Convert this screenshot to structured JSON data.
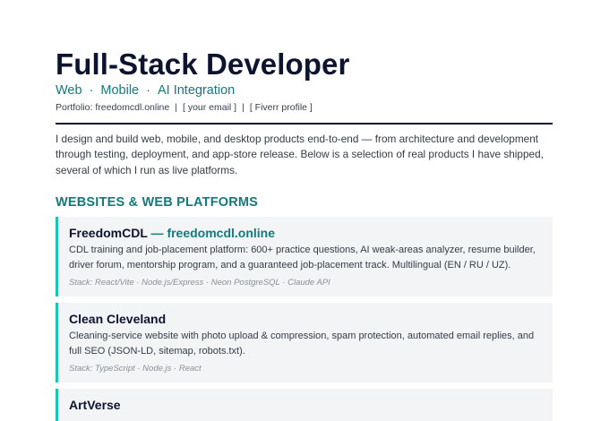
{
  "header": {
    "name": "Full-Stack Developer",
    "roles": [
      "Web",
      "Mobile",
      "AI Integration"
    ],
    "role_separator": "·",
    "links": {
      "portfolio": "Portfolio: freedomcdl.online",
      "email": "[ your email ]",
      "fiverr": "[ Fiverr profile ]",
      "separator": "|"
    }
  },
  "intro": "I design and build web, mobile, and desktop products end-to-end — from architecture and development through testing, deployment, and app-store release. Below is a selection of real products I have shipped, several of which I run as live platforms.",
  "section": {
    "title": "WEBSITES & WEB PLATFORMS"
  },
  "projects": [
    {
      "name": "FreedomCDL",
      "dash": " — ",
      "domain": "freedomcdl.online",
      "description": "CDL training and job-placement platform: 600+ practice questions, AI weak-areas analyzer, resume builder, driver forum, mentorship program, and a guaranteed job-placement track. Multilingual (EN / RU / UZ).",
      "stack": "Stack: React/Vite · Node.js/Express · Neon PostgreSQL · Claude API"
    },
    {
      "name": "Clean Cleveland",
      "description": "Cleaning-service website with photo upload & compression, spam protection, automated email replies, and full SEO (JSON-LD, sitemap, robots.txt).",
      "stack": "Stack: TypeScript · Node.js · React"
    },
    {
      "name": "ArtVerse"
    }
  ],
  "colors": {
    "heading": "#0d1430",
    "accent": "#137a7a",
    "card_border": "#19c7b0",
    "card_bg": "#f3f4f6"
  }
}
